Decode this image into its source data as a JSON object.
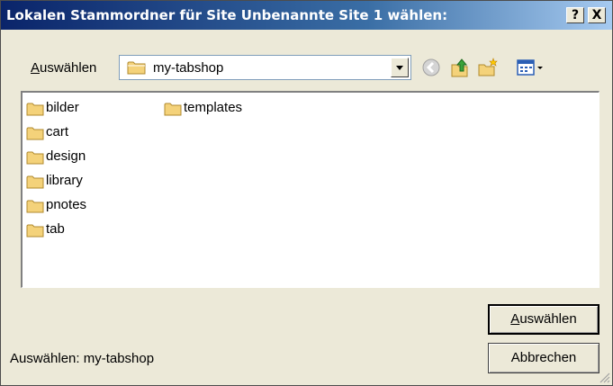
{
  "window": {
    "title": "Lokalen Stammordner für Site Unbenannte Site 1 wählen:",
    "help_label": "?",
    "close_label": "X"
  },
  "toolbar": {
    "lookin_accel": "A",
    "lookin_rest": "uswählen",
    "current_folder": "my-tabshop",
    "icons": [
      "back-icon",
      "up-folder-icon",
      "new-folder-icon",
      "views-menu-icon"
    ]
  },
  "files": [
    {
      "name": "bilder",
      "icon": "folder-icon"
    },
    {
      "name": "cart",
      "icon": "folder-icon"
    },
    {
      "name": "design",
      "icon": "folder-icon"
    },
    {
      "name": "library",
      "icon": "folder-icon"
    },
    {
      "name": "pnotes",
      "icon": "folder-icon"
    },
    {
      "name": "tab",
      "icon": "folder-icon"
    },
    {
      "name": "templates",
      "icon": "folder-icon"
    }
  ],
  "buttons": {
    "select_accel": "A",
    "select_rest": "uswählen",
    "cancel": "Abbrechen"
  },
  "status": {
    "text": "Auswählen: my-tabshop"
  },
  "colors": {
    "title_start": "#0a246a",
    "title_end": "#a6caf0",
    "dialog_bg": "#ECE9D8",
    "folder": "#f4d27a"
  }
}
